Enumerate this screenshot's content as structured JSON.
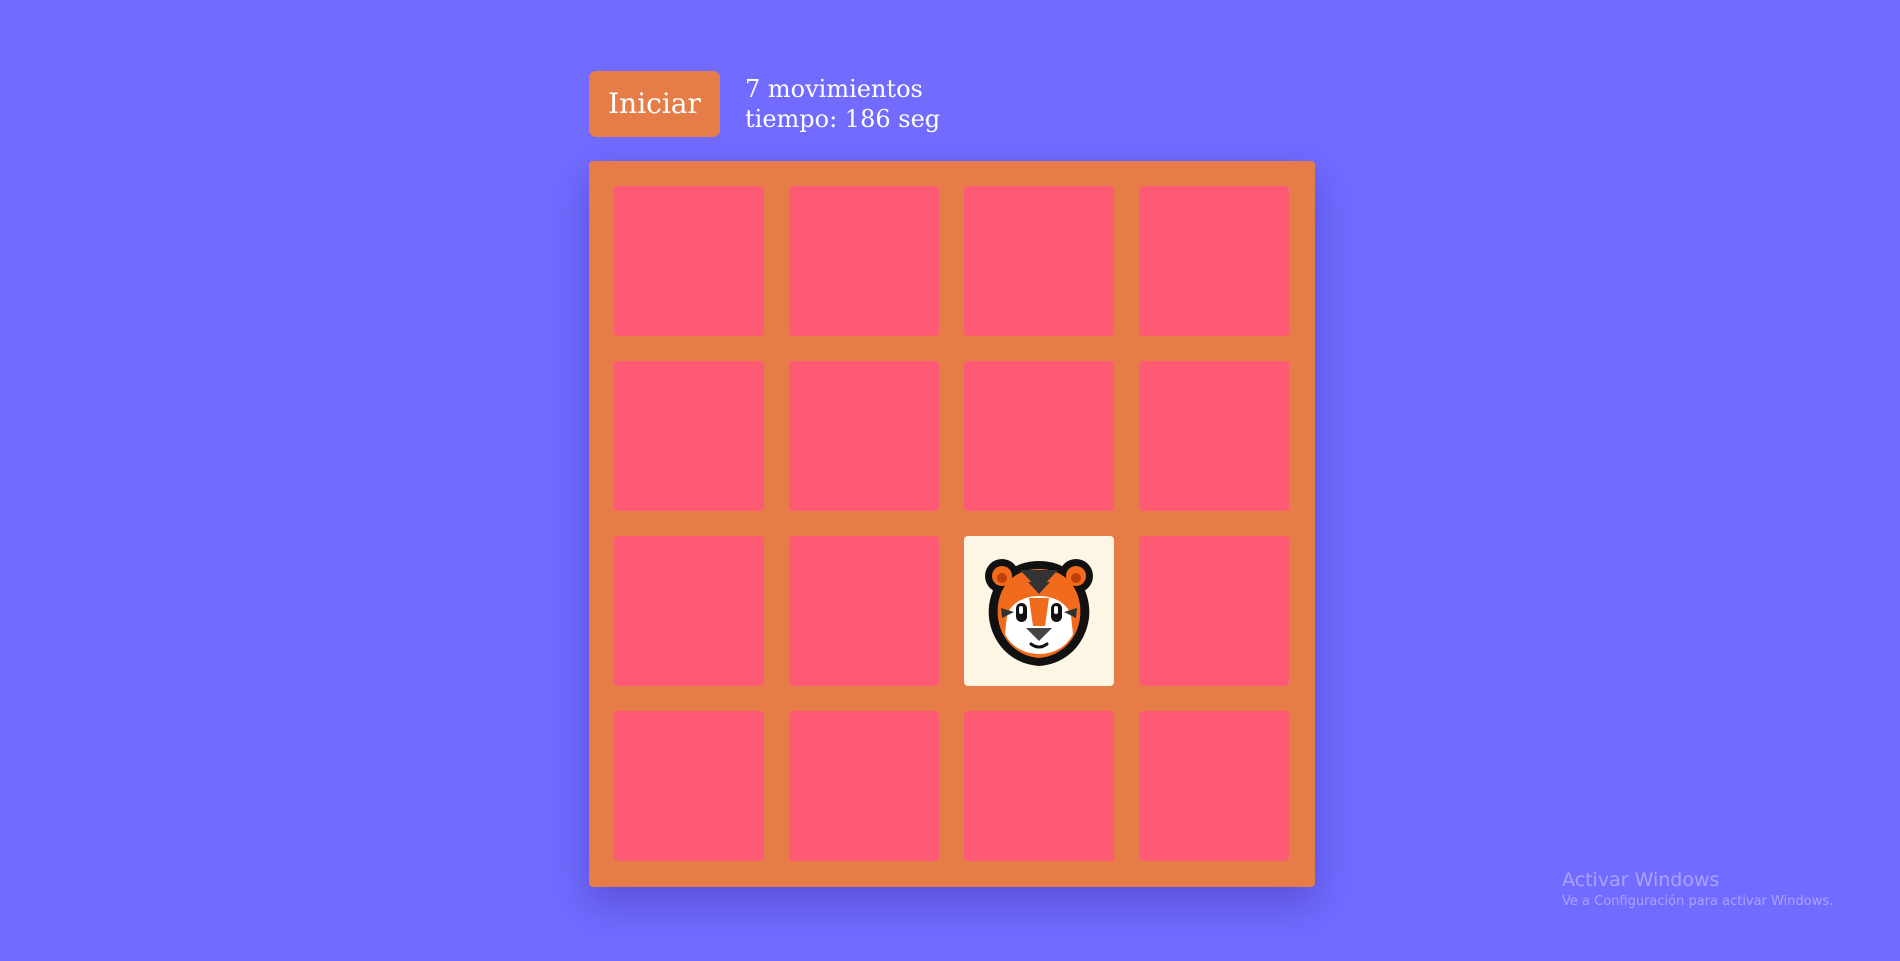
{
  "header": {
    "start_label": "Iniciar",
    "moves_text": "7 movimientos",
    "time_text": "tiempo: 186 seg"
  },
  "board": {
    "rows": 4,
    "cols": 4,
    "cards": [
      {
        "state": "hidden"
      },
      {
        "state": "hidden"
      },
      {
        "state": "hidden"
      },
      {
        "state": "hidden"
      },
      {
        "state": "hidden"
      },
      {
        "state": "hidden"
      },
      {
        "state": "hidden"
      },
      {
        "state": "hidden"
      },
      {
        "state": "hidden"
      },
      {
        "state": "hidden"
      },
      {
        "state": "revealed",
        "icon": "tiger-face-icon"
      },
      {
        "state": "hidden"
      },
      {
        "state": "hidden"
      },
      {
        "state": "hidden"
      },
      {
        "state": "hidden"
      },
      {
        "state": "hidden"
      }
    ]
  },
  "colors": {
    "background": "#716bff",
    "board": "#e67c47",
    "card_back": "#ff5a74",
    "card_front": "#fdf6e4"
  },
  "watermark": {
    "title": "Activar Windows",
    "subtitle": "Ve a Configuración para activar Windows."
  }
}
